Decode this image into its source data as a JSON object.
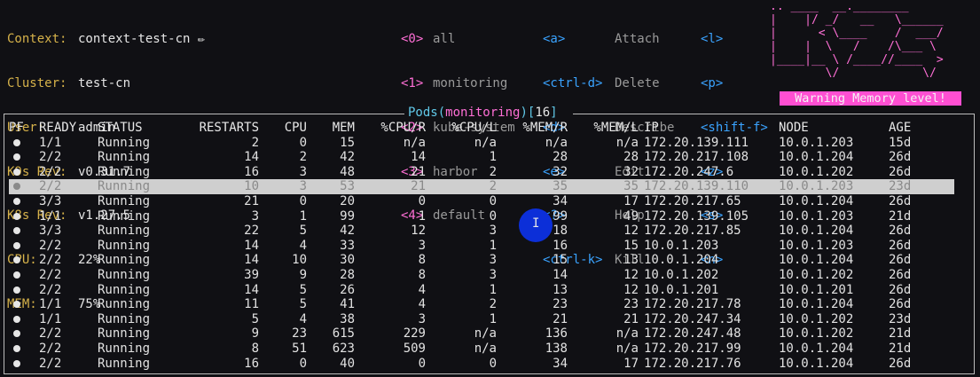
{
  "info": [
    {
      "key": "Context:",
      "value": "context-test-cn ✏"
    },
    {
      "key": "Cluster:",
      "value": "test-cn"
    },
    {
      "key": "User:",
      "value": "admin"
    },
    {
      "key": "K9s Rev:",
      "value": "v0.31.7"
    },
    {
      "key": "K8s Rev:",
      "value": "v1.27.5"
    },
    {
      "key": "CPU:",
      "value": "22%"
    },
    {
      "key": "MEM:",
      "value": "75%"
    }
  ],
  "namespaces": [
    {
      "key": "<0>",
      "label": "all"
    },
    {
      "key": "<1>",
      "label": "monitoring"
    },
    {
      "key": "<2>",
      "label": "kube-system"
    },
    {
      "key": "<3>",
      "label": "harbor"
    },
    {
      "key": "<4>",
      "label": "default"
    }
  ],
  "hotkeys": [
    {
      "key": "<a>",
      "label": "Attach"
    },
    {
      "key": "<ctrl-d>",
      "label": "Delete"
    },
    {
      "key": "<d>",
      "label": "Describe"
    },
    {
      "key": "<e>",
      "label": "Edit"
    },
    {
      "key": "<?>",
      "label": "Help"
    },
    {
      "key": "<ctrl-k>",
      "label": "Kill"
    }
  ],
  "hotkeys2": [
    "<l>",
    "<p>",
    "<shift-f>",
    "<z>",
    "<s>",
    "<n>"
  ],
  "logo_text": "K9s",
  "warning": "Warning Memory level!",
  "title": {
    "resource": "Pods",
    "namespace": "monitoring",
    "count": "16"
  },
  "columns": [
    "PF",
    "READY",
    "STATUS",
    "RESTARTS",
    "CPU",
    "MEM",
    "%CPU/R",
    "%CPU/L",
    "%MEM/R",
    "%MEM/L",
    "IP",
    "NODE",
    "AGE"
  ],
  "rows": [
    [
      "1/1",
      "Running",
      "2",
      "0",
      "15",
      "n/a",
      "n/a",
      "n/a",
      "n/a",
      "172.20.139.111",
      "10.0.1.203",
      "15d"
    ],
    [
      "2/2",
      "Running",
      "14",
      "2",
      "42",
      "14",
      "1",
      "28",
      "28",
      "172.20.217.108",
      "10.0.1.204",
      "26d"
    ],
    [
      "2/2",
      "Running",
      "16",
      "3",
      "48",
      "21",
      "2",
      "32",
      "32",
      "172.20.247.6",
      "10.0.1.202",
      "26d"
    ],
    [
      "2/2",
      "Running",
      "10",
      "3",
      "53",
      "21",
      "2",
      "35",
      "35",
      "172.20.139.110",
      "10.0.1.203",
      "23d"
    ],
    [
      "3/3",
      "Running",
      "21",
      "0",
      "20",
      "0",
      "0",
      "34",
      "17",
      "172.20.217.65",
      "10.0.1.204",
      "26d"
    ],
    [
      "1/1",
      "Running",
      "3",
      "1",
      "99",
      "1",
      "0",
      "99",
      "49",
      "172.20.139.105",
      "10.0.1.203",
      "21d"
    ],
    [
      "3/3",
      "Running",
      "22",
      "5",
      "42",
      "12",
      "3",
      "18",
      "12",
      "172.20.217.85",
      "10.0.1.204",
      "26d"
    ],
    [
      "2/2",
      "Running",
      "14",
      "4",
      "33",
      "3",
      "1",
      "16",
      "15",
      "10.0.1.203",
      "10.0.1.203",
      "26d"
    ],
    [
      "2/2",
      "Running",
      "14",
      "10",
      "30",
      "8",
      "3",
      "15",
      "13",
      "10.0.1.204",
      "10.0.1.204",
      "26d"
    ],
    [
      "2/2",
      "Running",
      "39",
      "9",
      "28",
      "8",
      "3",
      "14",
      "12",
      "10.0.1.202",
      "10.0.1.202",
      "26d"
    ],
    [
      "2/2",
      "Running",
      "14",
      "5",
      "26",
      "4",
      "1",
      "13",
      "12",
      "10.0.1.201",
      "10.0.1.201",
      "26d"
    ],
    [
      "1/1",
      "Running",
      "11",
      "5",
      "41",
      "4",
      "2",
      "23",
      "23",
      "172.20.217.78",
      "10.0.1.204",
      "26d"
    ],
    [
      "1/1",
      "Running",
      "5",
      "4",
      "38",
      "3",
      "1",
      "21",
      "21",
      "172.20.247.34",
      "10.0.1.202",
      "23d"
    ],
    [
      "2/2",
      "Running",
      "9",
      "23",
      "615",
      "229",
      "n/a",
      "136",
      "n/a",
      "172.20.247.48",
      "10.0.1.202",
      "21d"
    ],
    [
      "2/2",
      "Running",
      "8",
      "51",
      "623",
      "509",
      "n/a",
      "138",
      "n/a",
      "172.20.217.99",
      "10.0.1.204",
      "21d"
    ],
    [
      "2/2",
      "Running",
      "16",
      "0",
      "40",
      "0",
      "0",
      "34",
      "17",
      "172.20.217.76",
      "10.0.1.204",
      "26d"
    ]
  ],
  "selected_row": 3
}
